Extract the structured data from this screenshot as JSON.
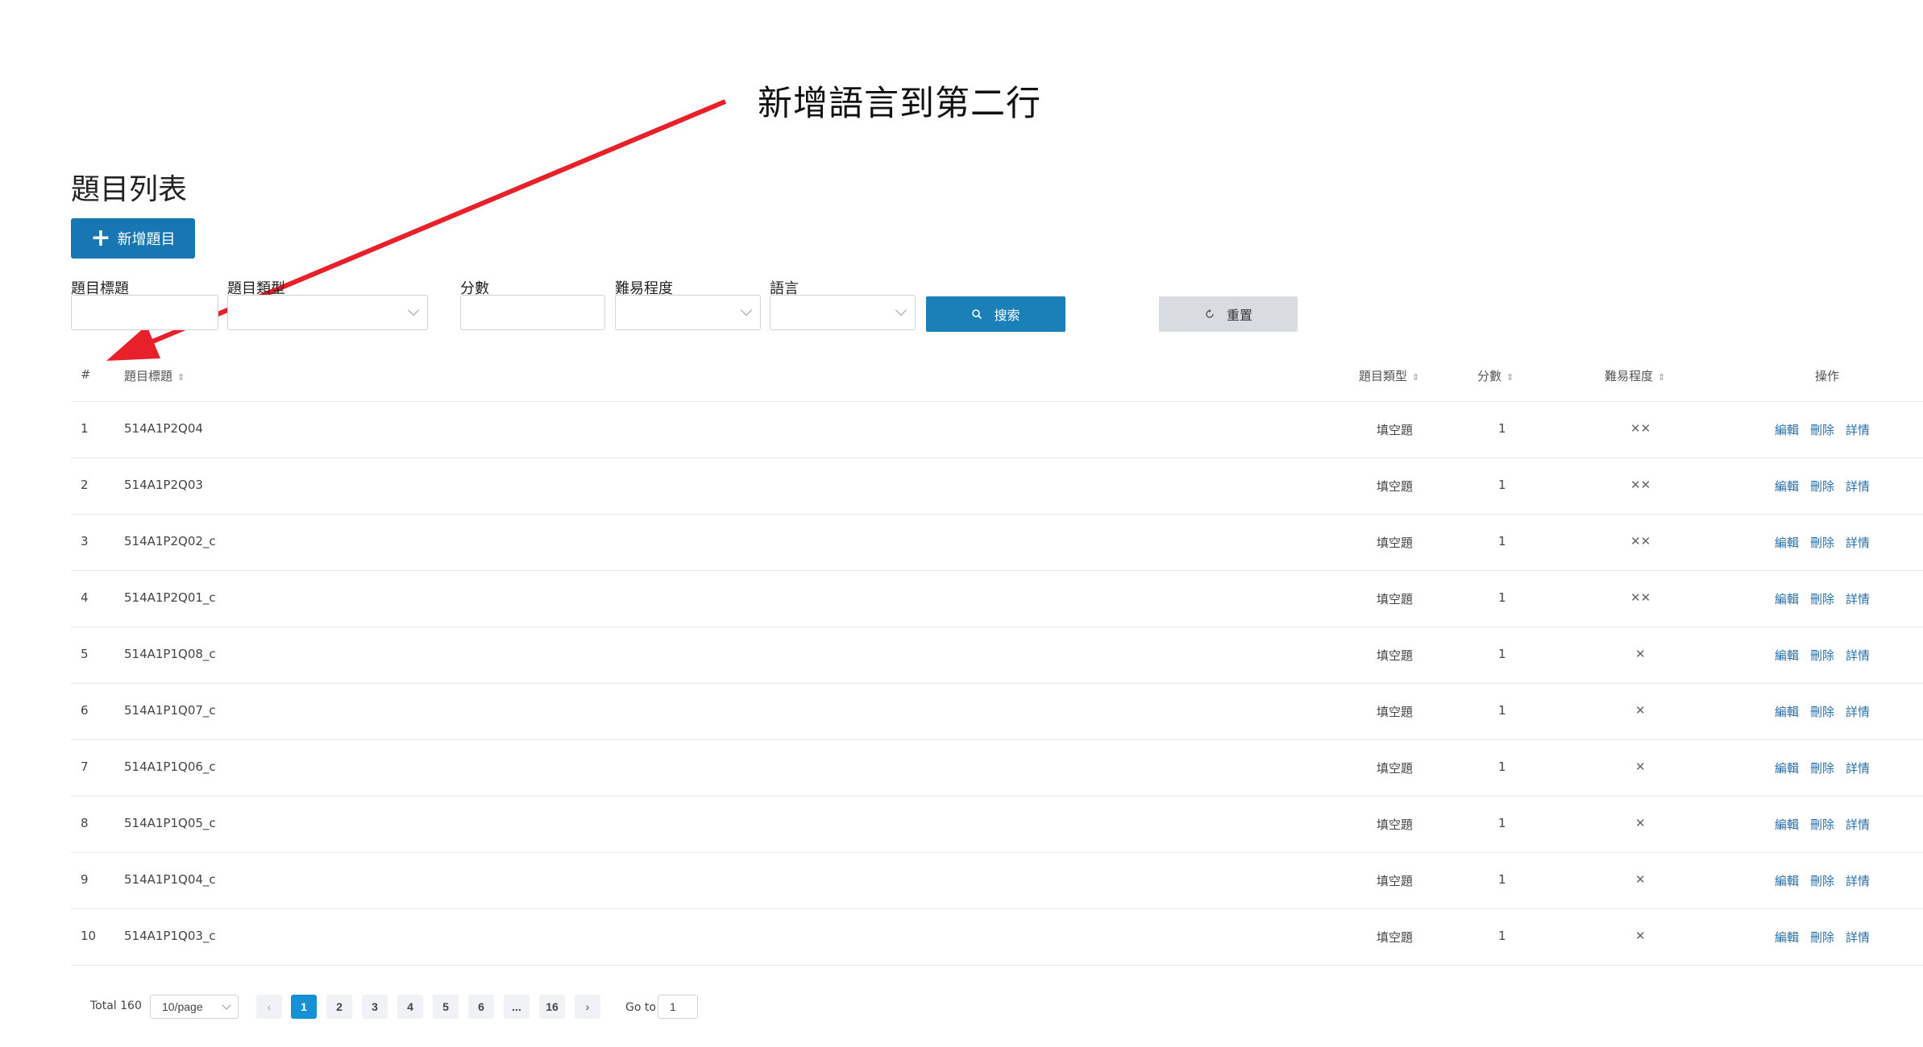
{
  "annotation": {
    "text": "新增語言到第二行"
  },
  "page": {
    "title": "題目列表"
  },
  "toolbar": {
    "add_label": "新增題目"
  },
  "filters": {
    "title_label": "題目標題",
    "type_label": "題目類型",
    "score_label": "分數",
    "difficulty_label": "難易程度",
    "language_label": "語言",
    "search_label": "搜索",
    "reset_label": "重置"
  },
  "table": {
    "headers": {
      "index": "#",
      "title": "題目標題",
      "type": "題目類型",
      "score": "分數",
      "difficulty": "難易程度",
      "actions": "操作"
    },
    "rows": [
      {
        "index": "1",
        "title": "514A1P2Q04",
        "type": "填空題",
        "score": "1",
        "difficulty": "✕✕"
      },
      {
        "index": "2",
        "title": "514A1P2Q03",
        "type": "填空題",
        "score": "1",
        "difficulty": "✕✕"
      },
      {
        "index": "3",
        "title": "514A1P2Q02_c",
        "type": "填空題",
        "score": "1",
        "difficulty": "✕✕"
      },
      {
        "index": "4",
        "title": "514A1P2Q01_c",
        "type": "填空題",
        "score": "1",
        "difficulty": "✕✕"
      },
      {
        "index": "5",
        "title": "514A1P1Q08_c",
        "type": "填空題",
        "score": "1",
        "difficulty": "✕"
      },
      {
        "index": "6",
        "title": "514A1P1Q07_c",
        "type": "填空題",
        "score": "1",
        "difficulty": "✕"
      },
      {
        "index": "7",
        "title": "514A1P1Q06_c",
        "type": "填空題",
        "score": "1",
        "difficulty": "✕"
      },
      {
        "index": "8",
        "title": "514A1P1Q05_c",
        "type": "填空題",
        "score": "1",
        "difficulty": "✕"
      },
      {
        "index": "9",
        "title": "514A1P1Q04_c",
        "type": "填空題",
        "score": "1",
        "difficulty": "✕"
      },
      {
        "index": "10",
        "title": "514A1P1Q03_c",
        "type": "填空題",
        "score": "1",
        "difficulty": "✕"
      }
    ],
    "actions": {
      "edit": "編輯",
      "delete": "刪除",
      "detail": "詳情"
    }
  },
  "pagination": {
    "total": "Total 160",
    "page_size": "10/page",
    "prev": "‹",
    "pages": [
      "1",
      "2",
      "3",
      "4",
      "5",
      "6",
      "...",
      "16"
    ],
    "active": "1",
    "next": "›",
    "goto_label": "Go to",
    "goto_value": "1"
  },
  "colors": {
    "primary": "#1677b3",
    "arrow": "#e8202a",
    "link": "#2a6fa8"
  }
}
